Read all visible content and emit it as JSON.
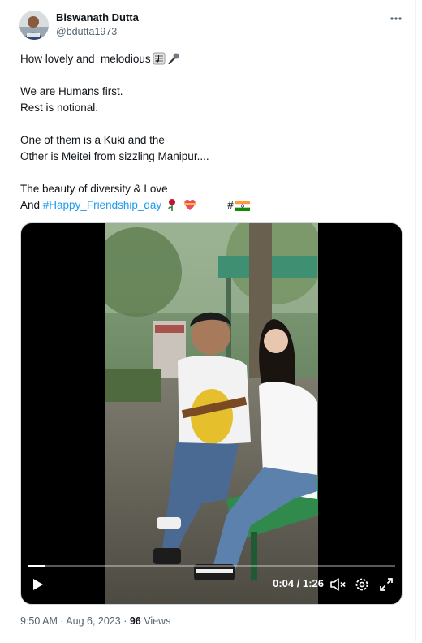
{
  "author": {
    "name": "Biswanath Dutta",
    "handle": "@bdutta1973"
  },
  "tweet": {
    "line1": "How lovely and  melodious",
    "line2": "We are Humans first.",
    "line3": "Rest is notional.",
    "line4": "One of them is a Kuki and the",
    "line5": "Other is Meitei from sizzling Manipur....",
    "line6": "The beauty of diversity & Love",
    "line7_prefix": "And ",
    "hashtag": "#Happy_Friendship_day",
    "hash_symbol": "#"
  },
  "video": {
    "time": "0:04 / 1:26",
    "progress": 0.047
  },
  "meta": {
    "time": "9:50 AM",
    "date": "Aug 6, 2023",
    "separator": " · ",
    "views_count": "96",
    "views_label": " Views"
  },
  "colors": {
    "link": "#1d9bf0",
    "secondary_text": "#536471",
    "primary_text": "#0f1419"
  },
  "icons": [
    "more-icon",
    "music-score-icon",
    "microphone-icon",
    "rose-icon",
    "heart-ribbon-icon",
    "india-flag-icon",
    "play-icon",
    "mute-icon",
    "settings-icon",
    "fullscreen-icon"
  ]
}
